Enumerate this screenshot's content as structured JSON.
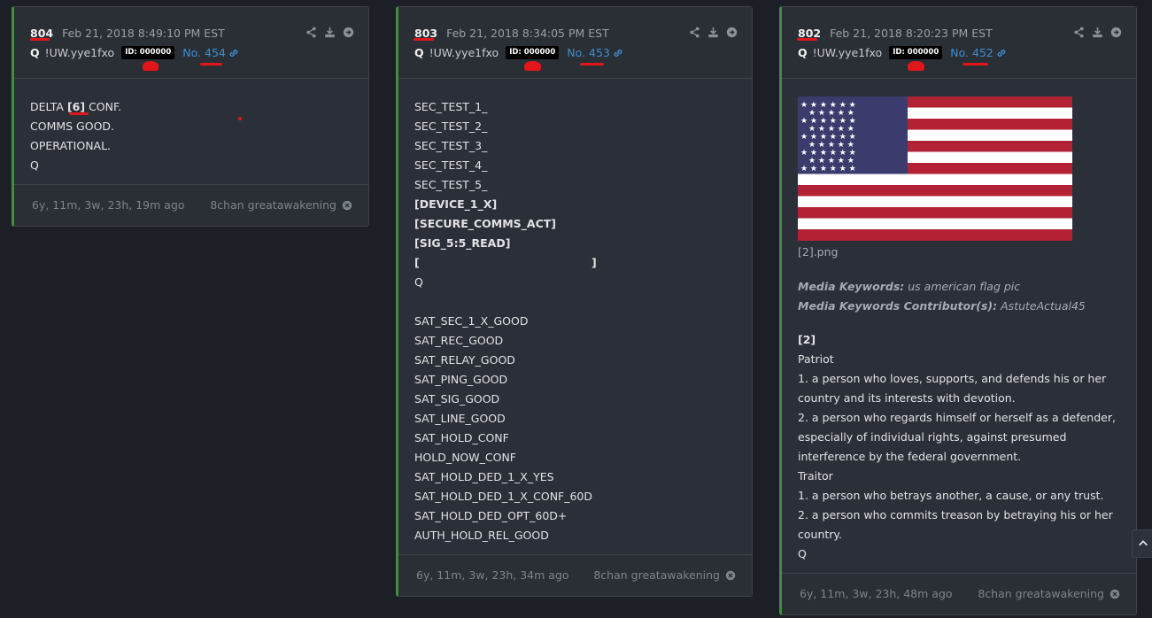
{
  "posts": [
    {
      "number": "804",
      "date": "Feb 21, 2018 8:49:10 PM EST",
      "author": "Q",
      "tripcode": "!UW.yye1fxo",
      "id_badge": "ID: 000000",
      "post_no": "No. 454",
      "lines": [
        "DELTA ",
        "[6]",
        " CONF.",
        "COMMS GOOD.",
        "OPERATIONAL.",
        "Q"
      ],
      "ago": "6y, 11m, 3w, 23h, 19m ago",
      "source": "8chan greatawakening"
    },
    {
      "number": "803",
      "date": "Feb 21, 2018 8:34:05 PM EST",
      "author": "Q",
      "tripcode": "!UW.yye1fxo",
      "id_badge": "ID: 000000",
      "post_no": "No. 453",
      "lines": [
        "SEC_TEST_1_",
        "SEC_TEST_2_",
        "SEC_TEST_3_",
        "SEC_TEST_4_",
        "SEC_TEST_5_",
        "[DEVICE_1_X]",
        "[SECURE_COMMS_ACT]",
        "[SIG_5:5_READ]",
        "[",
        "]",
        "Q",
        "SAT_SEC_1_X_GOOD",
        "SAT_REC_GOOD",
        "SAT_RELAY_GOOD",
        "SAT_PING_GOOD",
        "SAT_SIG_GOOD",
        "SAT_LINE_GOOD",
        "SAT_HOLD_CONF",
        "HOLD_NOW_CONF",
        "SAT_HOLD_DED_1_X_YES",
        "SAT_HOLD_DED_1_X_CONF_60D",
        "SAT_HOLD_DED_OPT_60D+",
        "AUTH_HOLD_REL_GOOD"
      ],
      "ago": "6y, 11m, 3w, 23h, 34m ago",
      "source": "8chan greatawakening"
    },
    {
      "number": "802",
      "date": "Feb 21, 2018 8:20:23 PM EST",
      "author": "Q",
      "tripcode": "!UW.yye1fxo",
      "id_badge": "ID: 000000",
      "post_no": "No. 452",
      "image_caption": "[2].png",
      "kw_label": "Media Keywords:",
      "kw_value": "us american flag pic",
      "kwc_label": "Media Keywords Contributor(s):",
      "kwc_value": "AstuteActual45",
      "lines": [
        "[2]",
        "Patriot",
        "1. a person who loves, supports, and defends his or her",
        "country and its interests with devotion.",
        "2. a person who regards himself or herself as a defender,",
        "especially of individual rights, against presumed",
        "interference by the federal government.",
        "Traitor",
        "1. a person who betrays another, a cause, or any trust.",
        "2. a person who commits treason by betraying his or her",
        "country.",
        "Q"
      ],
      "ago": "6y, 11m, 3w, 23h, 48m ago",
      "source": "8chan greatawakening"
    }
  ],
  "colors": {
    "accent_green": "#3f8f3f",
    "link_blue": "#3e8ed0",
    "mark_red": "#e0161a"
  }
}
